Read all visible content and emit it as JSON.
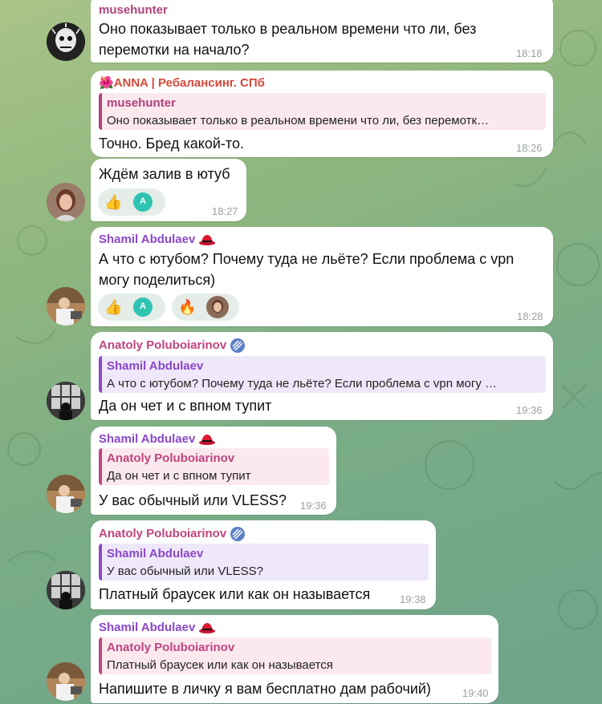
{
  "colors": {
    "muse": "#b0427a",
    "anna": "#d34a3c",
    "shamil": "#8a48c8",
    "anatoly": "#c0447f",
    "time": "#9aa39a"
  },
  "messages": [
    {
      "author": "musehunter",
      "lines": [
        "Оно показывает только в реальном времени что ли, без",
        "перемотки на начало?"
      ],
      "time": "18:18"
    },
    {
      "author": "ANNA | Ребалансинг. СПб",
      "author_icon": "hibiscus-icon",
      "reply_author": "musehunter",
      "reply_text": "Оно показывает только в реальном времени что ли, без перемотк…",
      "text": "Точно. Бред какой-то.",
      "time": "18:26"
    },
    {
      "text": "Ждём залив в ютуб",
      "reactions": [
        {
          "emoji": "👍",
          "user_initial": "A"
        }
      ],
      "time": "18:27"
    },
    {
      "author": "Shamil Abdulaev",
      "author_icon": "red-hat-icon",
      "lines": [
        "А что с ютубом? Почему туда не льёте? Если проблема с vpn",
        "могу поделиться)"
      ],
      "reactions": [
        {
          "emoji": "👍",
          "user_initial": "A"
        },
        {
          "emoji": "🔥"
        }
      ],
      "time": "18:28"
    },
    {
      "author": "Anatoly Poluboiarinov",
      "author_icon": "striped-badge-icon",
      "reply_author": "Shamil Abdulaev",
      "reply_text": "А что с ютубом? Почему туда не льёте? Если проблема с vpn могу …",
      "text": "Да он чет и с впном тупит",
      "time": "19:36"
    },
    {
      "author": "Shamil Abdulaev",
      "author_icon": "red-hat-icon",
      "reply_author": "Anatoly Poluboiarinov",
      "reply_text": "Да он чет и с впном тупит",
      "text": "У вас обычный или VLESS?",
      "time": "19:36"
    },
    {
      "author": "Anatoly Poluboiarinov",
      "author_icon": "striped-badge-icon",
      "reply_author": "Shamil Abdulaev",
      "reply_text": "У вас обычный или VLESS?",
      "text": "Платный браусек или как он называется",
      "time": "19:38"
    },
    {
      "author": "Shamil Abdulaev",
      "author_icon": "red-hat-icon",
      "reply_author": "Anatoly Poluboiarinov",
      "reply_text": "Платный браусек или как он называется",
      "text": "Напишите в личку я вам бесплатно дам рабочий)",
      "time": "19:40"
    }
  ]
}
